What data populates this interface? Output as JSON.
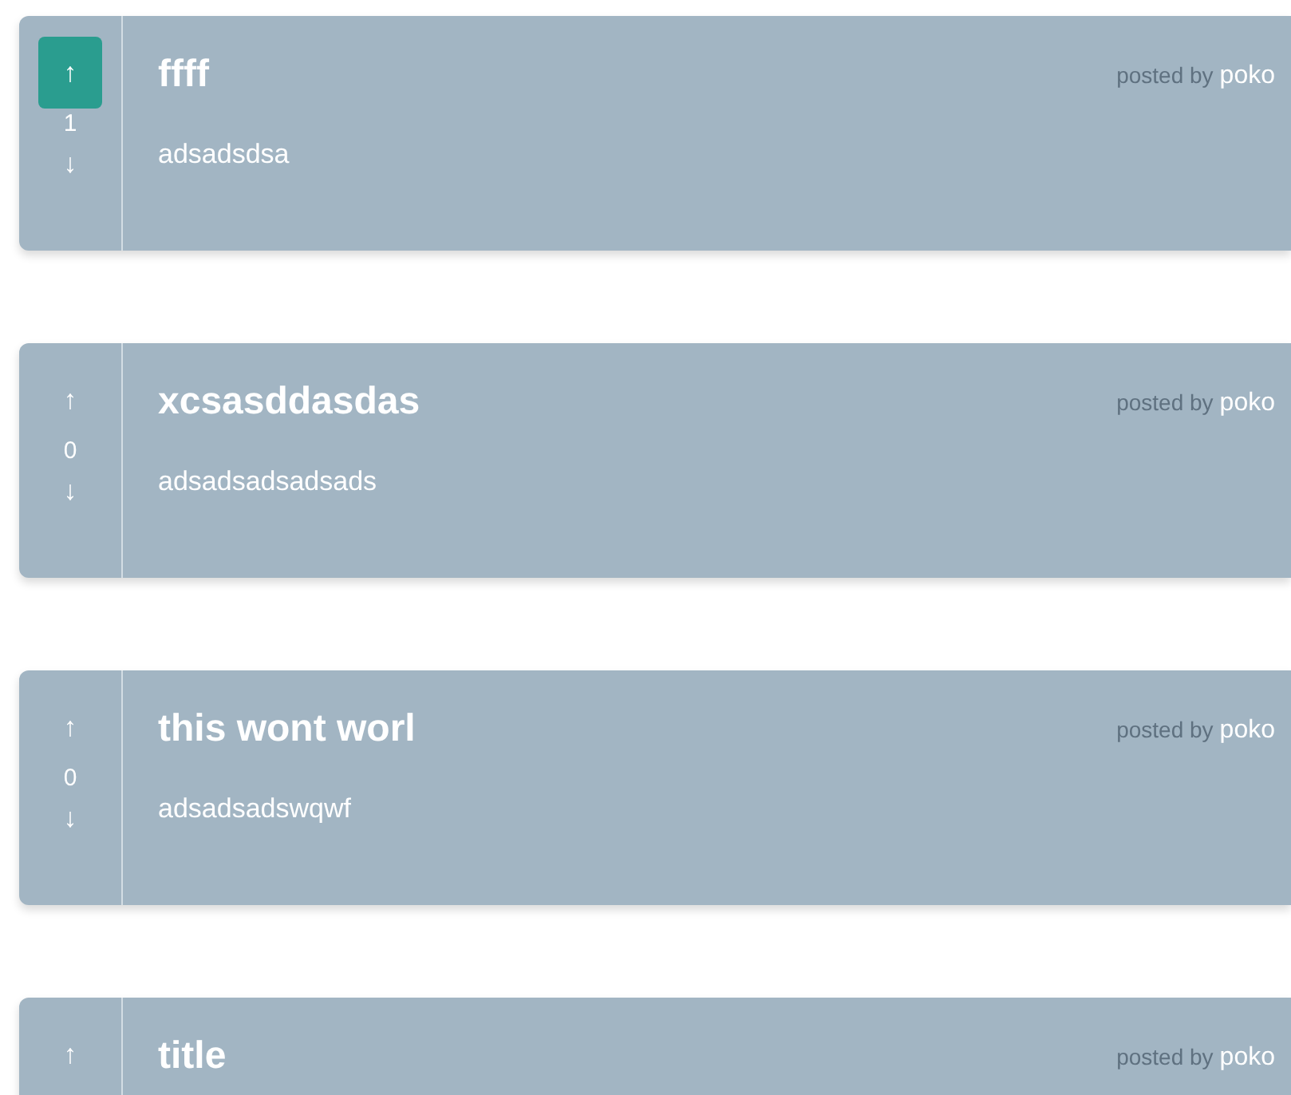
{
  "posts": [
    {
      "up_arrow": "↑",
      "score": "1",
      "down_arrow": "↓",
      "upvoted": true,
      "title": "ffff",
      "body": "adsadsdsa",
      "posted_by": "posted by",
      "author": "poko"
    },
    {
      "up_arrow": "↑",
      "score": "0",
      "down_arrow": "↓",
      "upvoted": false,
      "title": "xcsasddasdas",
      "body": "adsadsadsadsads",
      "posted_by": "posted by",
      "author": "poko"
    },
    {
      "up_arrow": "↑",
      "score": "0",
      "down_arrow": "↓",
      "upvoted": false,
      "title": "this wont worl",
      "body": "adsadsadswqwf",
      "posted_by": "posted by",
      "author": "poko"
    },
    {
      "up_arrow": "↑",
      "upvoted": false,
      "title": "title",
      "posted_by": "posted by",
      "author": "poko"
    }
  ]
}
